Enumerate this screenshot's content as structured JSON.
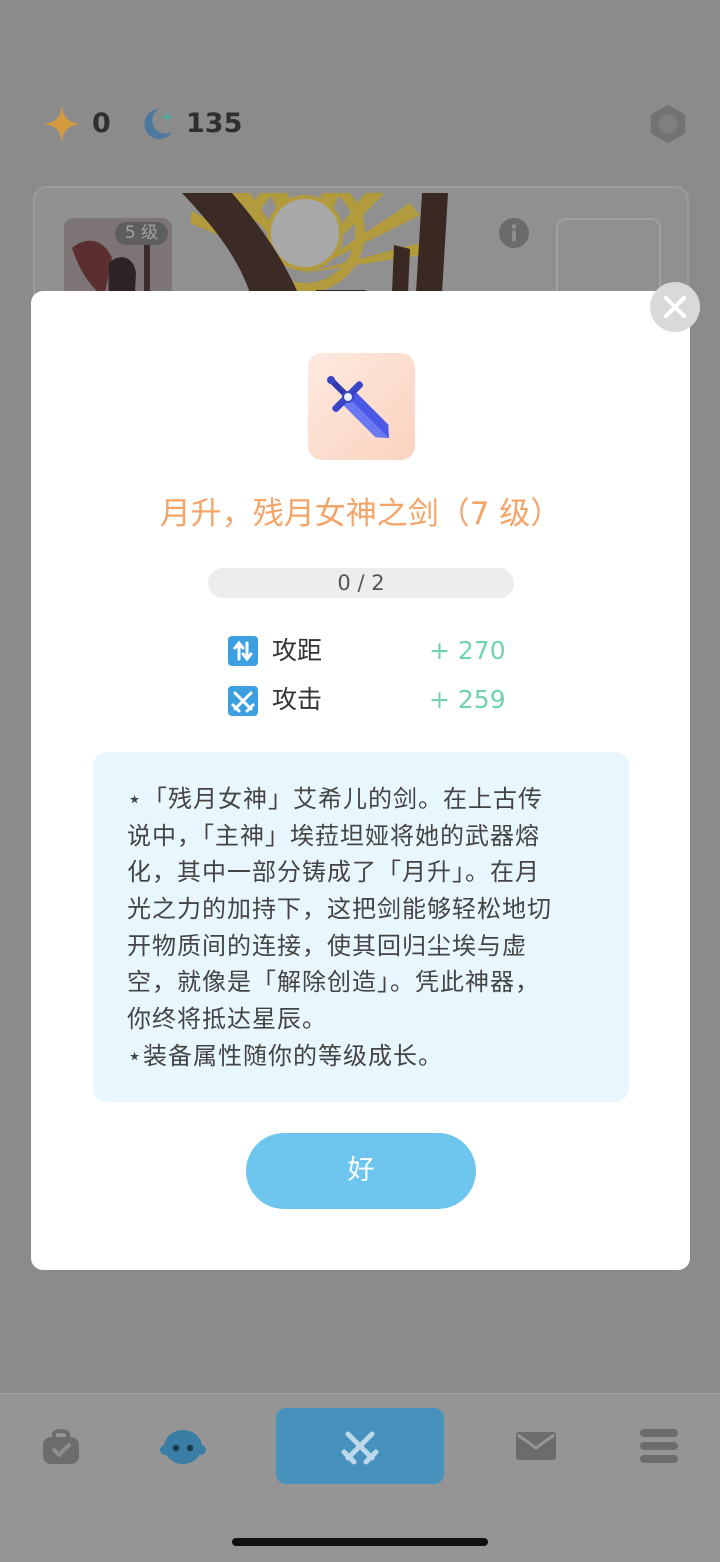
{
  "currency": {
    "stars": {
      "icon": "star-icon",
      "value": "0"
    },
    "moons": {
      "icon": "moon-icon",
      "value": "135"
    }
  },
  "settings": {
    "icon": "hexagon-settings-icon"
  },
  "hero_card": {
    "level_badge": "5 级",
    "info_icon": "info-icon"
  },
  "modal": {
    "close_icon": "close-icon",
    "item_icon": "sword-icon",
    "item_name": "月升，残月女神之剑（7 级）",
    "progress": {
      "text": "0 / 2",
      "fraction": 0
    },
    "stats": [
      {
        "icon": "range-arrows-icon",
        "label": "攻距",
        "value": "+ 270"
      },
      {
        "icon": "crossed-swords-icon",
        "label": "攻击",
        "value": "+ 259"
      }
    ],
    "description_lines": [
      "⋆「残月女神」艾希儿的剑。在上古传",
      "说中，「主神」埃菈坦娅将她的武器熔",
      "化，其中一部分铸成了「月升」。在月",
      "光之力的加持下，这把剑能够轻松地切",
      "开物质间的连接，使其回归尘埃与虚",
      "空，就像是「解除创造」。凭此神器，",
      "你终将抵达星辰。",
      "⋆装备属性随你的等级成长。"
    ],
    "confirm_label": "好"
  },
  "bottom_nav": {
    "items": [
      {
        "icon": "bag-icon",
        "active": false
      },
      {
        "icon": "character-face-icon",
        "active": false
      },
      {
        "icon": "crossed-swords-icon",
        "active": true
      },
      {
        "icon": "mail-icon",
        "active": false
      },
      {
        "icon": "menu-icon",
        "active": false
      }
    ]
  },
  "colors": {
    "title": "#f5a467",
    "stat_value": "#6fd3b3",
    "stat_icon": "#3e9fe0",
    "description_bg": "#e8f6fd",
    "confirm_button": "#6ec6ef",
    "active_nav": "#4692bd"
  }
}
